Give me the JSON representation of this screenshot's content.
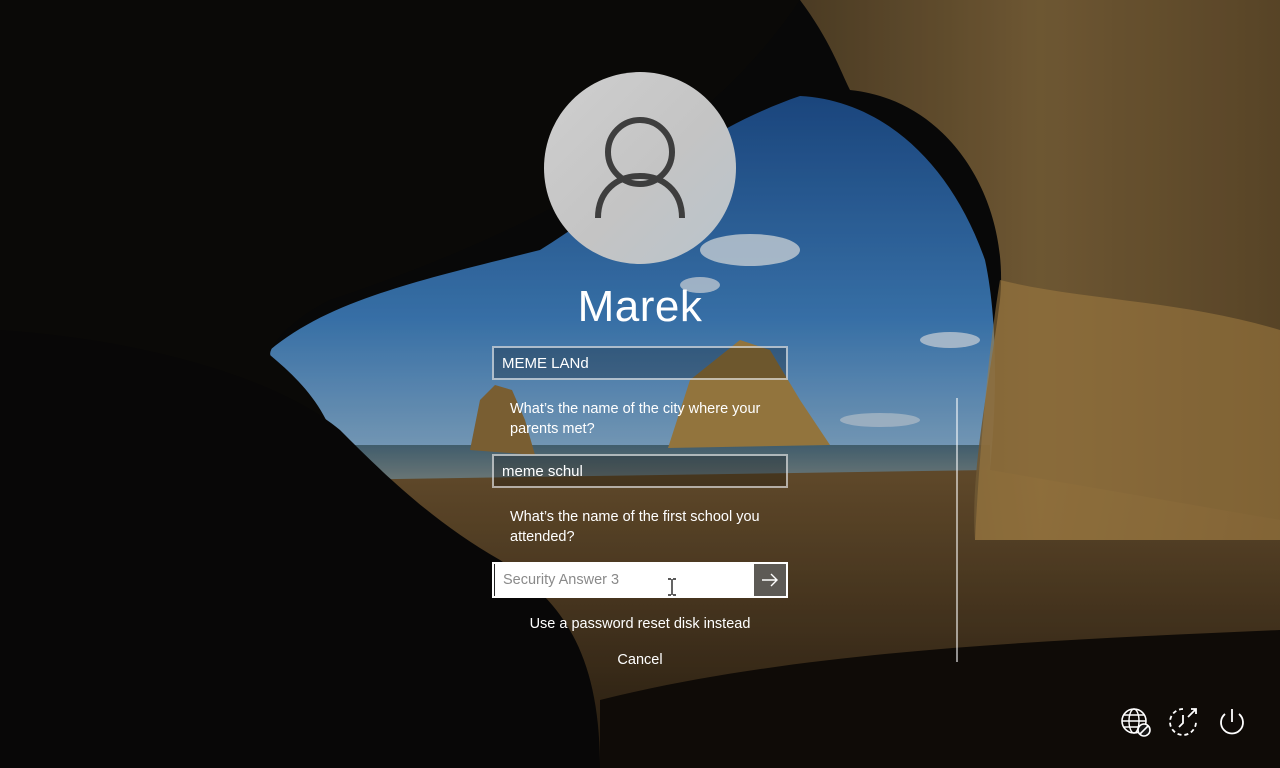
{
  "user": {
    "name": "Marek"
  },
  "security": {
    "answer1_value": "MEME LANd",
    "question2": "What’s the name of the city where your parents met?",
    "answer2_value": "meme schul",
    "question3": "What’s the name of the first school you attended?",
    "answer3_placeholder": "Security Answer 3"
  },
  "links": {
    "reset_disk": "Use a password reset disk instead",
    "cancel": "Cancel"
  },
  "tray": {
    "icons": [
      "network-icon",
      "ease-of-access-icon",
      "power-icon"
    ]
  }
}
